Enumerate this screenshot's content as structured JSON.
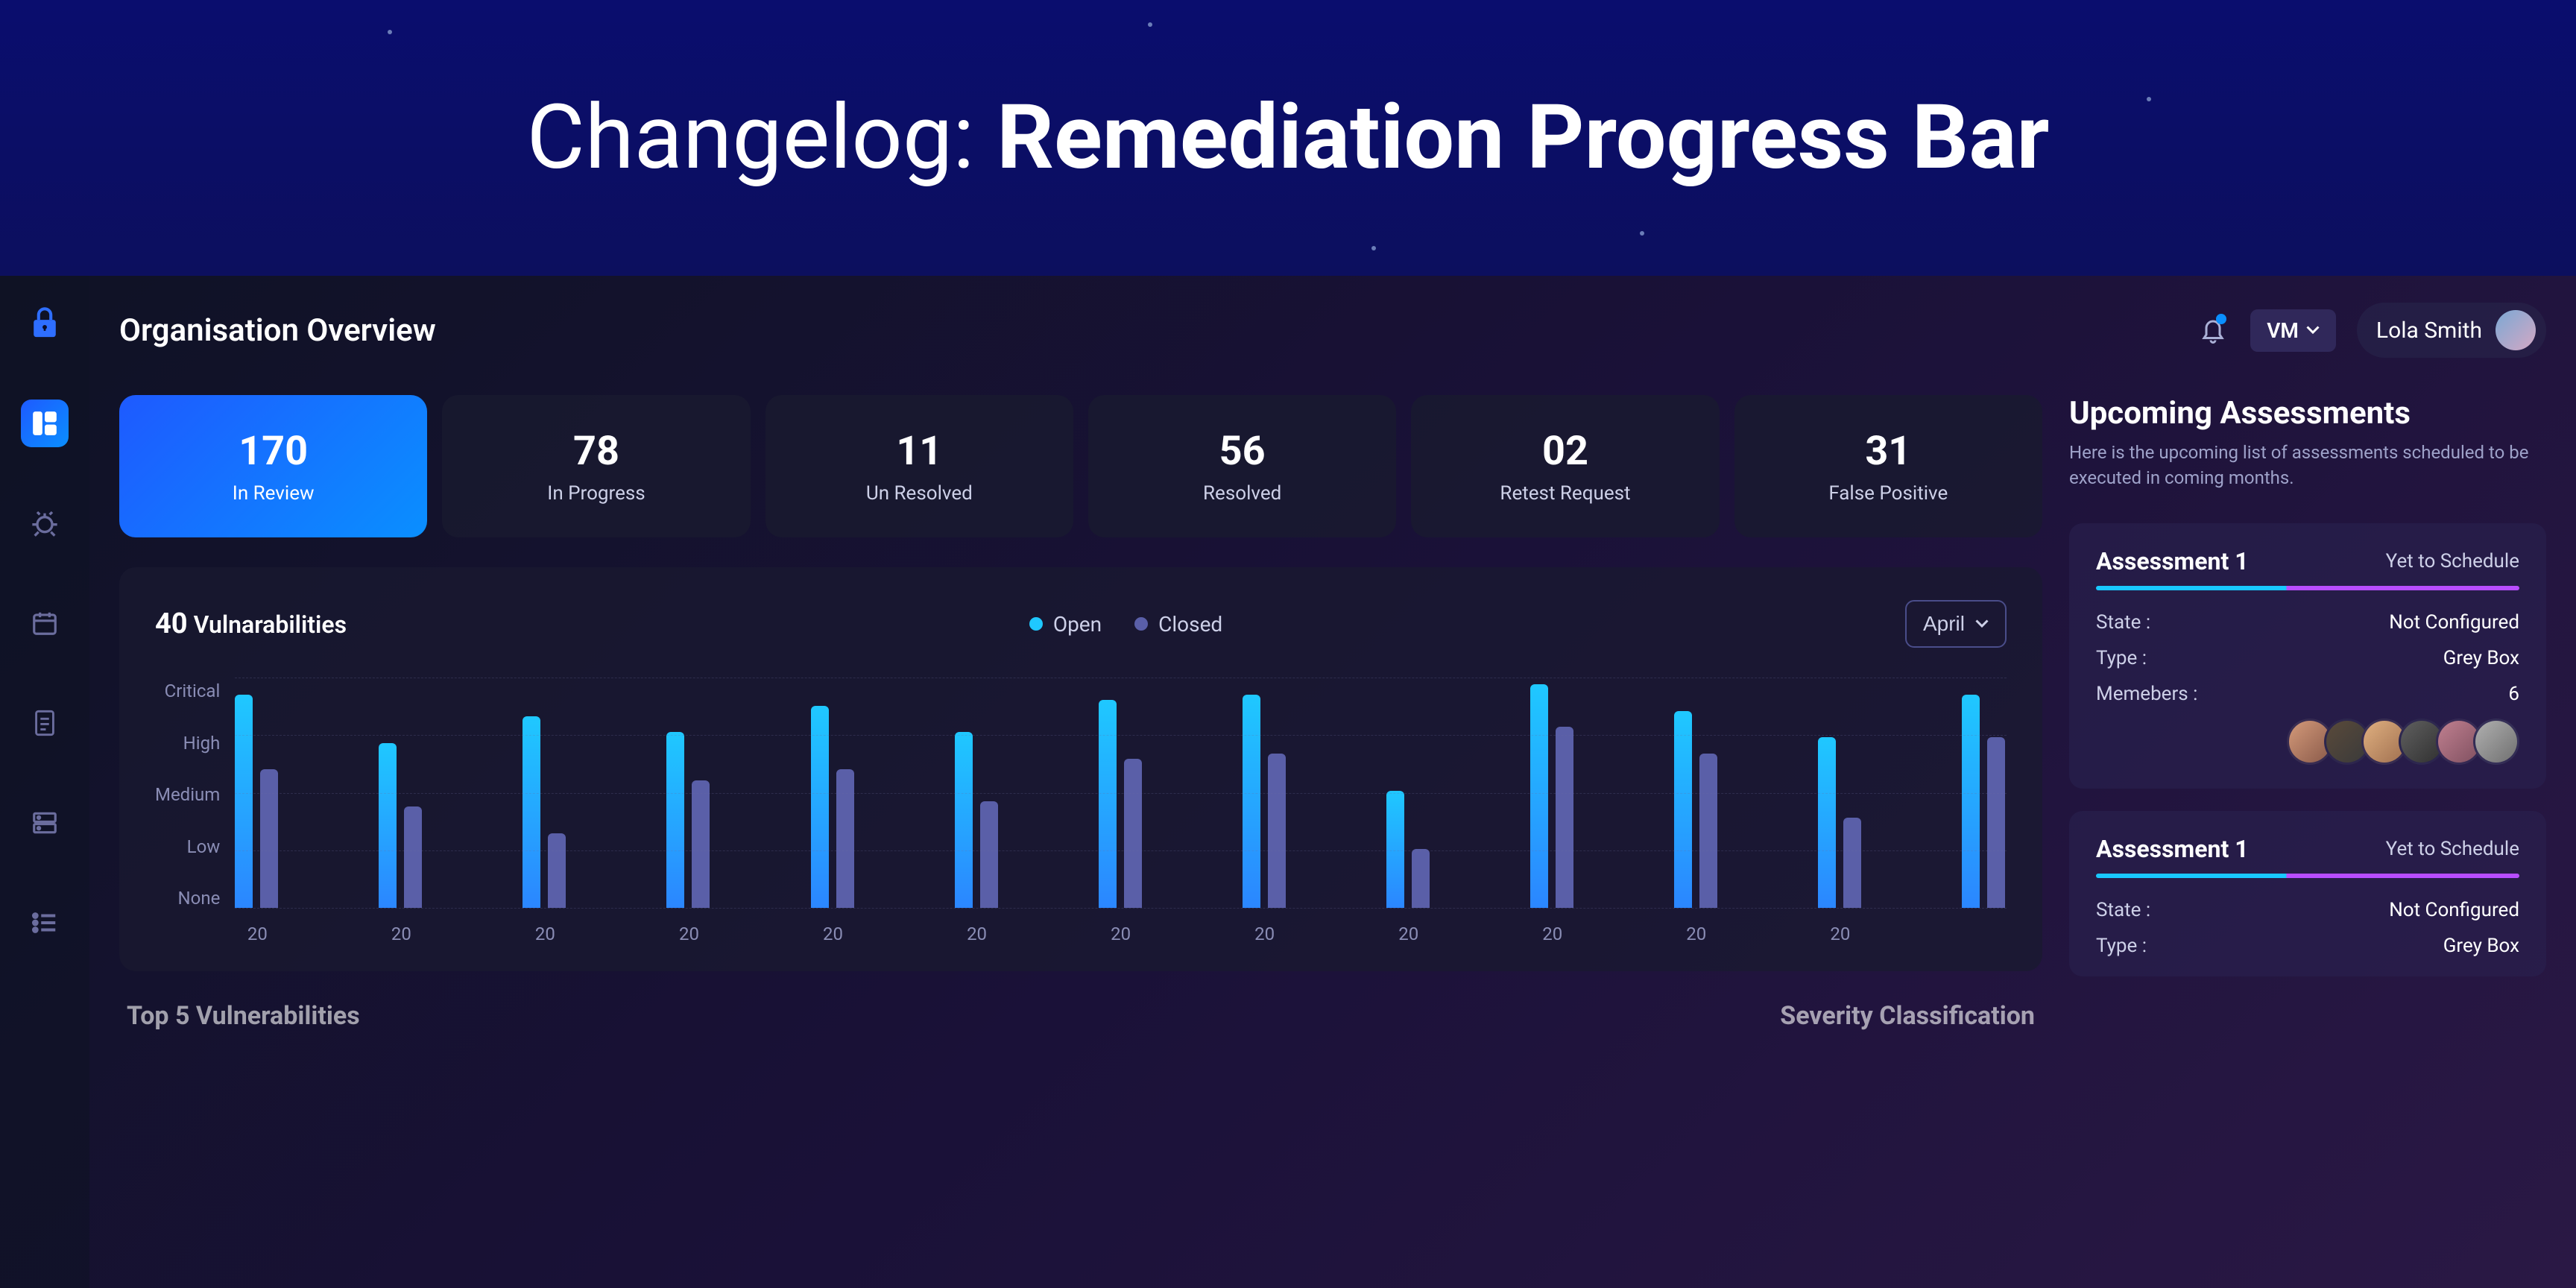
{
  "hero": {
    "prefix": "Changelog: ",
    "bold": "Remediation Progress Bar"
  },
  "header": {
    "page_title": "Organisation Overview",
    "vm_label": "VM",
    "user_name": "Lola Smith"
  },
  "colors": {
    "open": "#1fc8ff",
    "closed": "#5a5fa8",
    "accent": "#1e5aff"
  },
  "stats": [
    {
      "value": "170",
      "label": "In Review",
      "active": true
    },
    {
      "value": "78",
      "label": "In Progress"
    },
    {
      "value": "11",
      "label": "Un Resolved"
    },
    {
      "value": "56",
      "label": "Resolved"
    },
    {
      "value": "02",
      "label": "Retest Request"
    },
    {
      "value": "31",
      "label": "False Positive"
    }
  ],
  "chart": {
    "count": "40",
    "count_label": "Vulnarabilities",
    "legend_open": "Open",
    "legend_closed": "Closed",
    "month_label": "April"
  },
  "chart_data": {
    "type": "bar",
    "y_categories": [
      "Critical",
      "High",
      "Medium",
      "Low",
      "None"
    ],
    "x_labels": [
      "20",
      "20",
      "20",
      "20",
      "20",
      "20",
      "20",
      "20",
      "20",
      "20",
      "20",
      "20"
    ],
    "series": [
      {
        "name": "Open",
        "values": [
          4.0,
          3.1,
          3.6,
          3.3,
          3.8,
          3.3,
          3.9,
          4.0,
          2.2,
          4.2,
          3.7,
          3.2,
          4.0
        ]
      },
      {
        "name": "Closed",
        "values": [
          2.6,
          1.9,
          1.4,
          2.4,
          2.6,
          2.0,
          2.8,
          2.9,
          1.1,
          3.4,
          2.9,
          1.7,
          3.2
        ]
      }
    ],
    "y_max": 4.2,
    "xlabel": "",
    "ylabel": "",
    "title": ""
  },
  "bottom_sections": {
    "left": "Top 5 Vulnerabilities",
    "right": "Severity Classification"
  },
  "upcoming": {
    "title": "Upcoming Assessments",
    "subtitle": "Here is the upcoming list of assessments scheduled to be executed in coming months."
  },
  "assessments": [
    {
      "name": "Assessment 1",
      "status": "Yet to Schedule",
      "state_label": "State :",
      "state_value": "Not Configured",
      "type_label": "Type :",
      "type_value": "Grey Box",
      "members_label": "Memebers :",
      "members_value": "6",
      "show_avatars": true
    },
    {
      "name": "Assessment 1",
      "status": "Yet to Schedule",
      "state_label": "State :",
      "state_value": "Not Configured",
      "type_label": "Type :",
      "type_value": "Grey Box"
    }
  ]
}
